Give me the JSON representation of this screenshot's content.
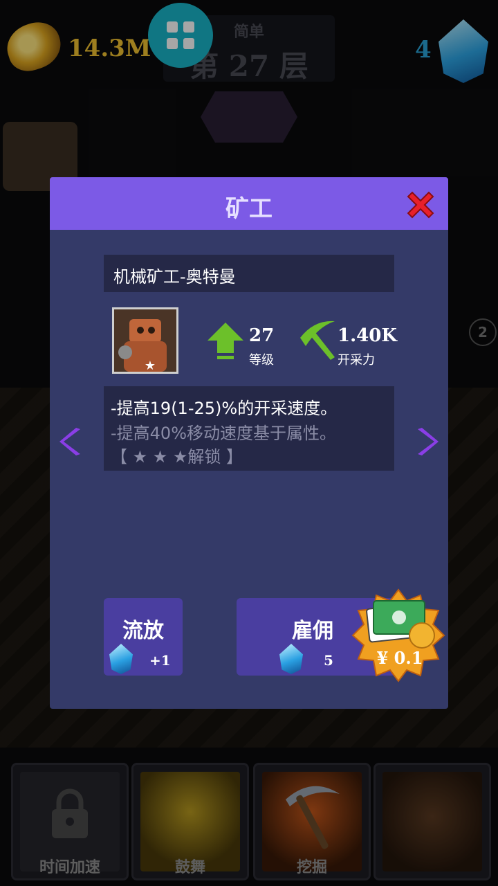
{
  "hud": {
    "gold_amount": "14.3M",
    "level_difficulty": "简单",
    "level_floor": "第 27 层",
    "gem_count": "4"
  },
  "side": {
    "badge": "2"
  },
  "modal": {
    "title": "矿工",
    "miner_name": "机械矿工-奥特曼",
    "level_value": "27",
    "level_label": "等级",
    "power_value": "1.40K",
    "power_label": "开采力",
    "desc_line1": "-提高19(1-25)%的开采速度。",
    "desc_line2": "-提高40%移动速度基于属性。",
    "desc_line3": "【 ★ ★ ★解锁 】",
    "exile_label": "流放",
    "exile_gem_count": "+1",
    "hire_label": "雇佣",
    "hire_gem_count": "5",
    "price": "¥ 0.1"
  },
  "skills": [
    {
      "label": "时间加速"
    },
    {
      "label": "鼓舞"
    },
    {
      "label": "挖掘"
    },
    {
      "label": ""
    }
  ],
  "colors": {
    "accent_purple": "#7c5ae6",
    "modal_body": "#343a68",
    "gold": "#f2c230",
    "gem_blue": "#2aa4d8"
  }
}
